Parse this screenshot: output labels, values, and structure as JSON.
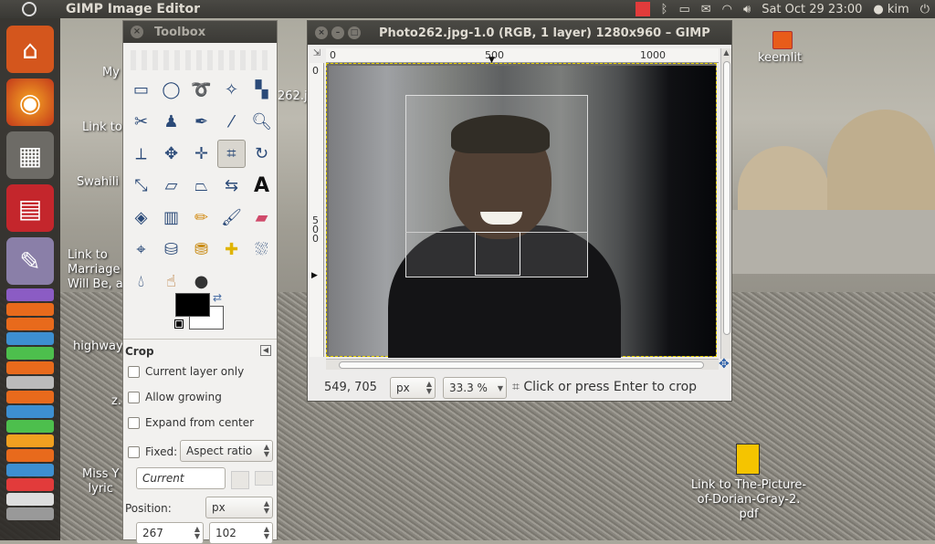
{
  "panel": {
    "title": "GIMP Image Editor",
    "clock": "Sat Oct 29 23:00",
    "user": "kim"
  },
  "desktop": {
    "labels": [
      "My",
      "Link to",
      "Swahili",
      "Link to\nMarriage\nWill Be, a",
      "highway",
      "z.",
      "Miss Y\nlyric"
    ],
    "folder_label": "keemlit",
    "pdf_label": "Link to The-Picture-\nof-Dorian-Gray-2.\npdf",
    "thumb_label": "262.jp"
  },
  "toolbox": {
    "title": "Toolbox",
    "options": {
      "title": "Crop",
      "current_layer_only": "Current layer only",
      "allow_growing": "Allow growing",
      "expand_from_center": "Expand from center",
      "fixed": "Fixed:",
      "fixed_value": "Aspect ratio",
      "current": "Current",
      "position_label": "Position:",
      "position_unit": "px",
      "pos_x": "267",
      "pos_y": "102"
    }
  },
  "image_window": {
    "title": "Photo262.jpg-1.0 (RGB, 1 layer) 1280x960 – GIMP",
    "ruler_h": [
      "0",
      "500",
      "1000"
    ],
    "ruler_v": [
      "0",
      "5\n0\n0"
    ],
    "coords": "549, 705",
    "unit": "px",
    "zoom": "33.3 %",
    "status": "Click or press Enter to crop"
  },
  "colors": {
    "accent": "#2b5ea7",
    "panel": "#3b3a36",
    "selection": "#e6d200"
  }
}
